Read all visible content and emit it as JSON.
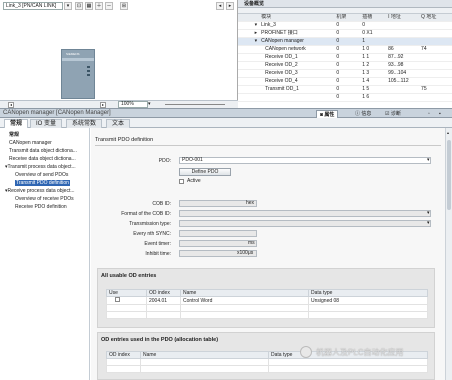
{
  "toolbar": {
    "device_select": "Link_3 [PN/CAN LINK]",
    "zoom": "100%"
  },
  "device_module": {
    "label": "SIEMENS"
  },
  "overview": {
    "title": "设备概览",
    "columns": [
      "模块",
      "机架",
      "插槽",
      "I 地址",
      "Q 地址"
    ],
    "rows": [
      {
        "name": "Link_3",
        "rack": "0",
        "slot": "0",
        "i": "",
        "q": ""
      },
      {
        "name": "PROFINET 接口",
        "rack": "0",
        "slot": "0 X1",
        "i": "",
        "q": ""
      },
      {
        "name": "CANopen manager",
        "rack": "0",
        "slot": "1",
        "i": "",
        "q": ""
      },
      {
        "name": "CANopen network",
        "rack": "0",
        "slot": "1 0",
        "i": "86",
        "q": "74"
      },
      {
        "name": "Receive OD_1",
        "rack": "0",
        "slot": "1 1",
        "i": "87...92",
        "q": ""
      },
      {
        "name": "Receive OD_2",
        "rack": "0",
        "slot": "1 2",
        "i": "93...98",
        "q": ""
      },
      {
        "name": "Receive OD_3",
        "rack": "0",
        "slot": "1 3",
        "i": "99...104",
        "q": ""
      },
      {
        "name": "Receive OD_4",
        "rack": "0",
        "slot": "1 4",
        "i": "105...112",
        "q": ""
      },
      {
        "name": "Transmit OD_1",
        "rack": "0",
        "slot": "1 5",
        "i": "",
        "q": "75"
      },
      {
        "name": "",
        "rack": "0",
        "slot": "1 6",
        "i": "",
        "q": ""
      }
    ]
  },
  "panel": {
    "title": "CANopen manager [CANopen Manager]",
    "tab_properties": "属性",
    "tab_info": "信息",
    "tab_diag": "诊断"
  },
  "subtabs": [
    "常规",
    "IO 变量",
    "系统常数",
    "文本"
  ],
  "nav": {
    "header": "常规",
    "items": [
      "CANopen manager",
      "Transmit data object dictiona...",
      "Receive data object dictiona...",
      "Transmit process data object...",
      "Transmit PDO definition",
      "Receive process data object...",
      "Overview of receive PDOs",
      "Receive PDO definition"
    ],
    "sub_overview_send": "Overview of send PDOs"
  },
  "form": {
    "section_title": "Transmit PDO definition",
    "pdo_label": "PDO:",
    "pdo_value": "PDO-001",
    "define_button": "Define PDO",
    "active_label": "Active",
    "cob_id_label": "COB ID:",
    "cob_id_unit": "hex",
    "format_label": "Format of the COB ID:",
    "transmission_label": "Transmission type:",
    "every_sync_label": "Every nth SYNC:",
    "event_timer_label": "Event timer:",
    "event_timer_unit": "ms",
    "inhibit_label": "Inhibit time:",
    "inhibit_unit": "x100μs"
  },
  "usable": {
    "title": "All usable OD entries",
    "columns": [
      "Use",
      "OD index",
      "Name",
      "Data type"
    ],
    "rows": [
      {
        "use": "",
        "index": "2004.01",
        "name": "Control Word",
        "type": "Unsigned 08"
      }
    ]
  },
  "used": {
    "title": "OD entries used in the PDO (allocation table)",
    "columns": [
      "OD index",
      "Name",
      "Data type"
    ]
  },
  "watermark": "机器人及PLC自动化应用"
}
